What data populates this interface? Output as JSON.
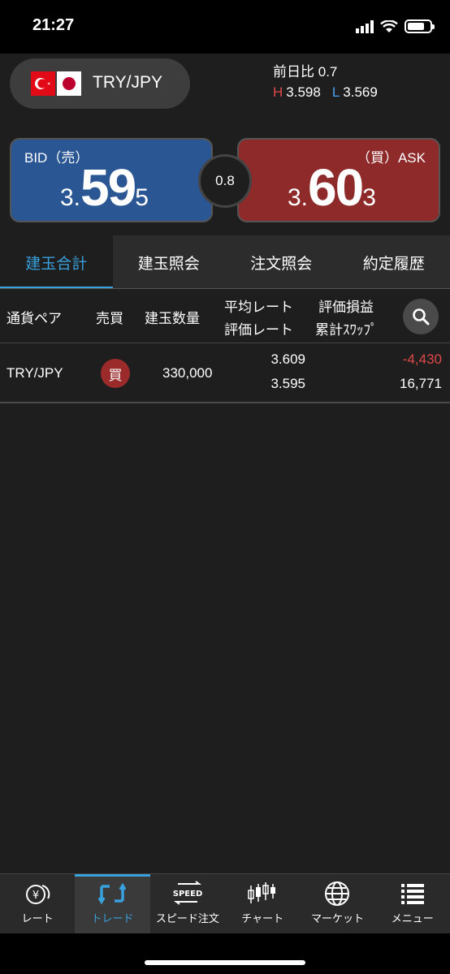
{
  "status_bar": {
    "time": "21:27"
  },
  "header": {
    "pair": "TRY/JPY",
    "prev_change_label": "前日比",
    "prev_change_value": "0.7",
    "high_label": "H",
    "high_value": "3.598",
    "low_label": "L",
    "low_value": "3.569"
  },
  "quote": {
    "bid_label": "BID（売）",
    "bid_price_prefix": "3.",
    "bid_price_big": "59",
    "bid_price_suffix": "5",
    "ask_label": "（買）ASK",
    "ask_price_prefix": "3.",
    "ask_price_big": "60",
    "ask_price_suffix": "3",
    "spread": "0.8"
  },
  "tabs": [
    {
      "label": "建玉合計",
      "active": true
    },
    {
      "label": "建玉照会",
      "active": false
    },
    {
      "label": "注文照会",
      "active": false
    },
    {
      "label": "約定履歴",
      "active": false
    }
  ],
  "table": {
    "headers": {
      "pair": "通貨ペア",
      "side": "売買",
      "qty": "建玉数量",
      "avg_rate": "平均レート",
      "eval_rate": "評価レート",
      "eval_pl": "評価損益",
      "total_swap": "累計ｽﾜｯﾌﾟ"
    },
    "rows": [
      {
        "pair": "TRY/JPY",
        "side": "買",
        "qty": "330,000",
        "avg_rate": "3.609",
        "eval_rate": "3.595",
        "eval_pl": "-4,430",
        "total_swap": "16,771"
      }
    ]
  },
  "nav": [
    {
      "label": "レート",
      "icon": "rate-yen-icon"
    },
    {
      "label": "トレード",
      "icon": "trade-icon",
      "active": true
    },
    {
      "label": "スピード注文",
      "icon": "speed-order-icon"
    },
    {
      "label": "チャート",
      "icon": "candlestick-chart-icon"
    },
    {
      "label": "マーケット",
      "icon": "globe-icon"
    },
    {
      "label": "メニュー",
      "icon": "menu-list-icon"
    }
  ],
  "colors": {
    "accent": "#38a0dc",
    "bid": "#2a5694",
    "ask": "#8e2a2a",
    "negative": "#e04848"
  }
}
